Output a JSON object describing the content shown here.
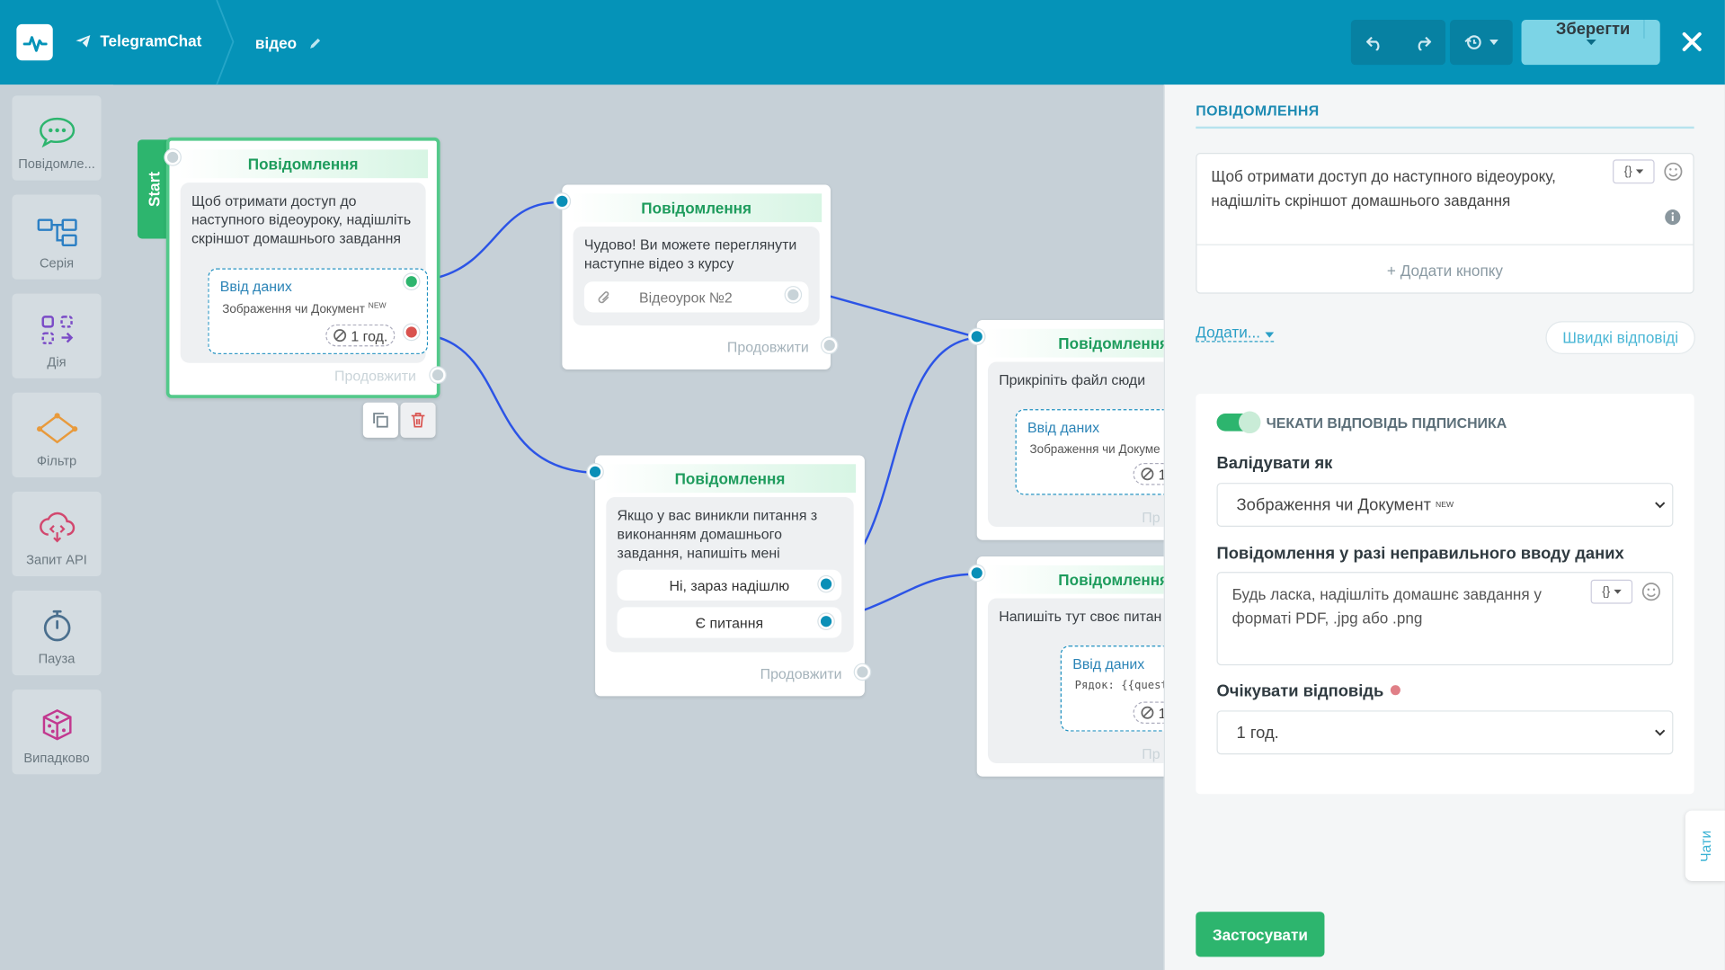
{
  "header": {
    "bot_name": "TelegramChat",
    "flow_name": "відео",
    "save_label": "Зберегти"
  },
  "sidebar": {
    "items": [
      {
        "label": "Повідомле..."
      },
      {
        "label": "Серія"
      },
      {
        "label": "Дія"
      },
      {
        "label": "Фільтр"
      },
      {
        "label": "Запит API"
      },
      {
        "label": "Пауза"
      },
      {
        "label": "Випадково"
      }
    ]
  },
  "canvas": {
    "start_label": "Start",
    "continue_label": "Продовжити",
    "node1": {
      "title": "Повідомлення",
      "text": "Щоб отримати доступ до наступного відеоуроку, надішліть скріншот домашнього завдання",
      "data_title": "Ввід даних",
      "data_type": "Зображення чи Документ",
      "data_badge": "NEW",
      "timer": "1 год."
    },
    "node2": {
      "title": "Повідомлення",
      "text": "Чудово! Ви можете переглянути наступне відео з курсу",
      "attachment": "Відеоурок №2"
    },
    "node3": {
      "title": "Повідомлення",
      "text": "Якщо у вас виникли питання з виконанням домашнього завдання, напишіть мені",
      "choice1": "Ні, зараз надішлю",
      "choice2": "Є питання"
    },
    "node4": {
      "title": "Повідомлення",
      "text": "Прикріпіть файл сюди",
      "data_title": "Ввід даних",
      "data_type": "Зображення чи Докуме",
      "timer": "1",
      "cont_cut": "Пр"
    },
    "node5": {
      "title": "Повідомлення",
      "text": "Напишіть тут своє питан",
      "data_title": "Ввід даних",
      "data_type": "Рядок: {{quest",
      "timer": "1",
      "cont_cut": "Пр"
    }
  },
  "panel": {
    "title": "ПОВІДОМЛЕННЯ",
    "message_text": "Щоб отримати доступ до наступного відеоуроку, надішліть скріншот домашнього завдання",
    "var_button": "{}",
    "add_button": "+ Додати кнопку",
    "add_link": "Додати...",
    "quick_replies": "Швидкі відповіді",
    "wait_toggle": "ЧЕКАТИ ВІДПОВІДЬ ПІДПИСНИКА",
    "validate_label": "Валідувати як",
    "validate_value": "Зображення чи Документ",
    "validate_badge": "NEW",
    "error_label": "Повідомлення у разі неправильного вводу даних",
    "error_text": "Будь ласка, надішліть домашнє завдання у форматі PDF, .jpg або .png",
    "wait_label": "Очікувати відповідь",
    "wait_value": "1 год.",
    "apply": "Застосувати",
    "chats_tab": "Чати"
  },
  "colors": {
    "header": "#0593b8",
    "accent_green": "#2db56e",
    "connector_blue": "#2c54e6",
    "node_title_green": "#1e9c5d"
  }
}
